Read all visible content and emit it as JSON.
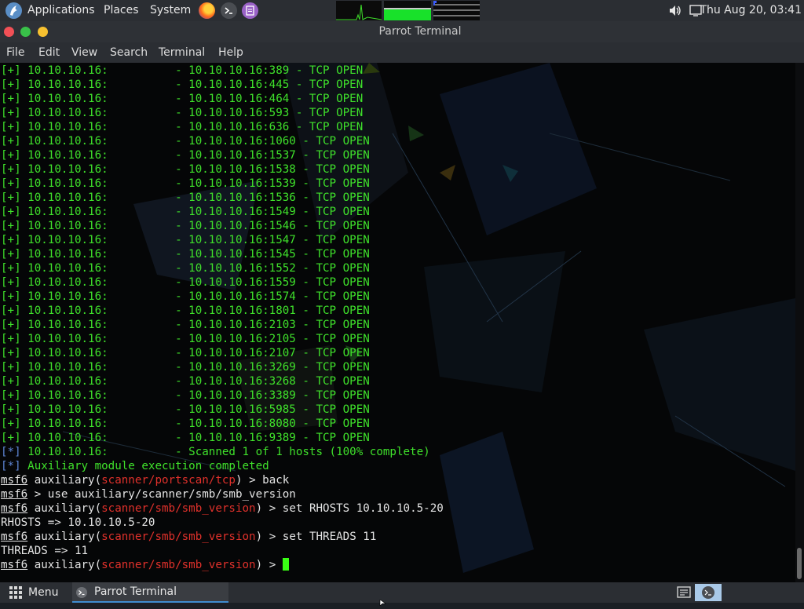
{
  "top_panel": {
    "applications_label": "Applications",
    "places_label": "Places",
    "system_label": "System",
    "clock": "Thu Aug 20, 03:41",
    "icons": {
      "logo": "parrot-logo-icon",
      "firefox": "firefox-icon",
      "terminal": "terminal-icon",
      "notes": "notes-icon",
      "volume": "volume-icon",
      "screen": "screen-icon"
    }
  },
  "window": {
    "title": "Parrot Terminal",
    "menu": [
      "File",
      "Edit",
      "View",
      "Search",
      "Terminal",
      "Help"
    ]
  },
  "terminal": {
    "ip": "10.10.10.16:",
    "open_ports": [
      "- 10.10.10.16:389 - TCP OPEN",
      "- 10.10.10.16:445 - TCP OPEN",
      "- 10.10.10.16:464 - TCP OPEN",
      "- 10.10.10.16:593 - TCP OPEN",
      "- 10.10.10.16:636 - TCP OPEN",
      "- 10.10.10.16:1060 - TCP OPEN",
      "- 10.10.10.16:1537 - TCP OPEN",
      "- 10.10.10.16:1538 - TCP OPEN",
      "- 10.10.10.16:1539 - TCP OPEN",
      "- 10.10.10.16:1536 - TCP OPEN",
      "- 10.10.10.16:1549 - TCP OPEN",
      "- 10.10.10.16:1546 - TCP OPEN",
      "- 10.10.10.16:1547 - TCP OPEN",
      "- 10.10.10.16:1545 - TCP OPEN",
      "- 10.10.10.16:1552 - TCP OPEN",
      "- 10.10.10.16:1559 - TCP OPEN",
      "- 10.10.10.16:1574 - TCP OPEN",
      "- 10.10.10.16:1801 - TCP OPEN",
      "- 10.10.10.16:2103 - TCP OPEN",
      "- 10.10.10.16:2105 - TCP OPEN",
      "- 10.10.10.16:2107 - TCP OPEN",
      "- 10.10.10.16:3269 - TCP OPEN",
      "- 10.10.10.16:3268 - TCP OPEN",
      "- 10.10.10.16:3389 - TCP OPEN",
      "- 10.10.10.16:5985 - TCP OPEN",
      "- 10.10.10.16:8080 - TCP OPEN",
      "- 10.10.10.16:9389 - TCP OPEN"
    ],
    "plus_marker": "[+]",
    "star_marker": "[*]",
    "scanned_line": "- Scanned 1 of 1 hosts (100% complete)",
    "module_completed": "Auxiliary module execution completed",
    "prompt_word": "msf6",
    "aux_word": "auxiliary(",
    "aux_close": ")",
    "prompt_arrow": " > ",
    "module_portscan": "scanner/portscan/tcp",
    "module_smb": "scanner/smb/smb_version",
    "cmd_back": "back",
    "cmd_use": "use auxiliary/scanner/smb/smb_version",
    "cmd_rhosts": "set RHOSTS 10.10.10.5-20",
    "out_rhosts": "RHOSTS => 10.10.10.5-20",
    "cmd_threads": "set THREADS 11",
    "out_threads": "THREADS => 11"
  },
  "bottom_panel": {
    "menu_label": "Menu",
    "task_label": "Parrot Terminal"
  },
  "colors": {
    "terminal_green": "#3fe12b",
    "module_red": "#e0312b",
    "info_blue": "#5f86d6",
    "accent_blue": "#3f8ccf"
  }
}
